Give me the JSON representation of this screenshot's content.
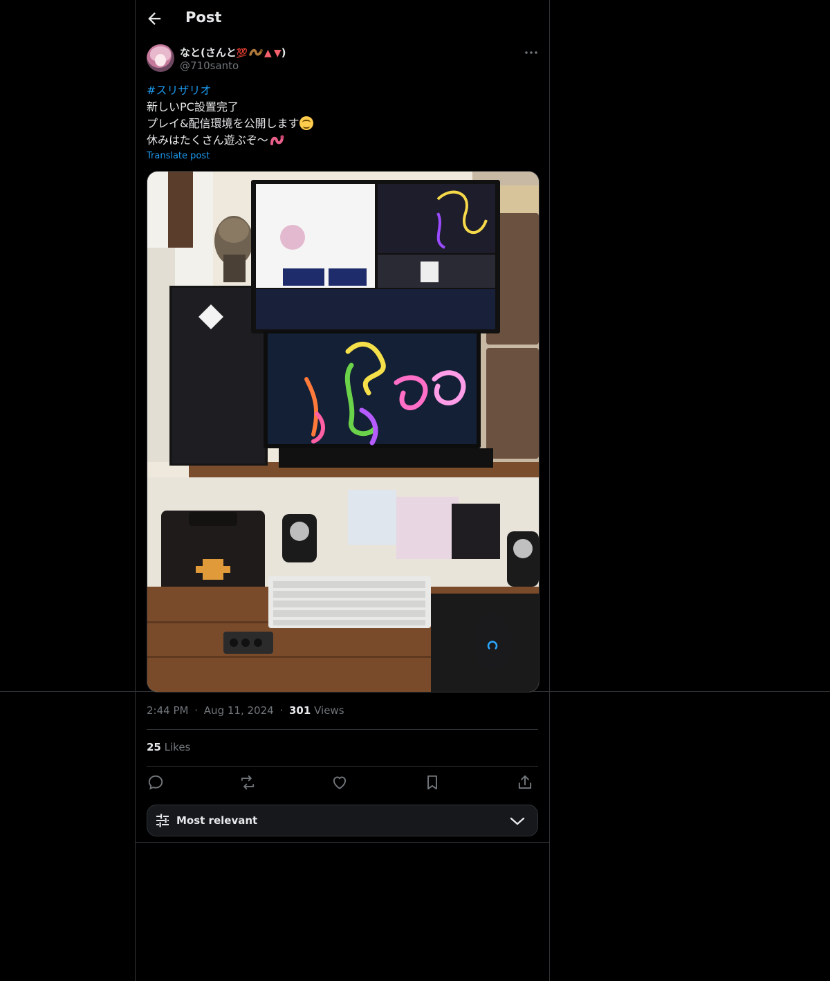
{
  "header": {
    "title": "Post"
  },
  "author": {
    "name": "なと(さんと",
    "name_emoji_100": "💯",
    "name_close": ")",
    "handle": "@710santo"
  },
  "post": {
    "hashtag": "#スリザリオ",
    "line2": "新しいPC設置完了",
    "line3": "プレイ&配信環境を公開します",
    "line4": "休みはたくさん遊ぶぞ〜",
    "translate": "Translate post",
    "media_alt": "PC desk setup photo"
  },
  "meta": {
    "time": "2:44 PM",
    "dot1": "·",
    "date": "Aug 11, 2024",
    "dot2": "·",
    "views_count": "301",
    "views_label": "Views"
  },
  "engagement": {
    "likes_count": "25",
    "likes_label": "Likes"
  },
  "actions": [
    "reply-icon",
    "repost-icon",
    "like-icon",
    "bookmark-icon",
    "share-icon"
  ],
  "replies_sort": {
    "label": "Most relevant"
  },
  "colors": {
    "accent": "#1d9bf0",
    "background": "#000000",
    "border": "#2f3336",
    "muted": "#71767b"
  }
}
